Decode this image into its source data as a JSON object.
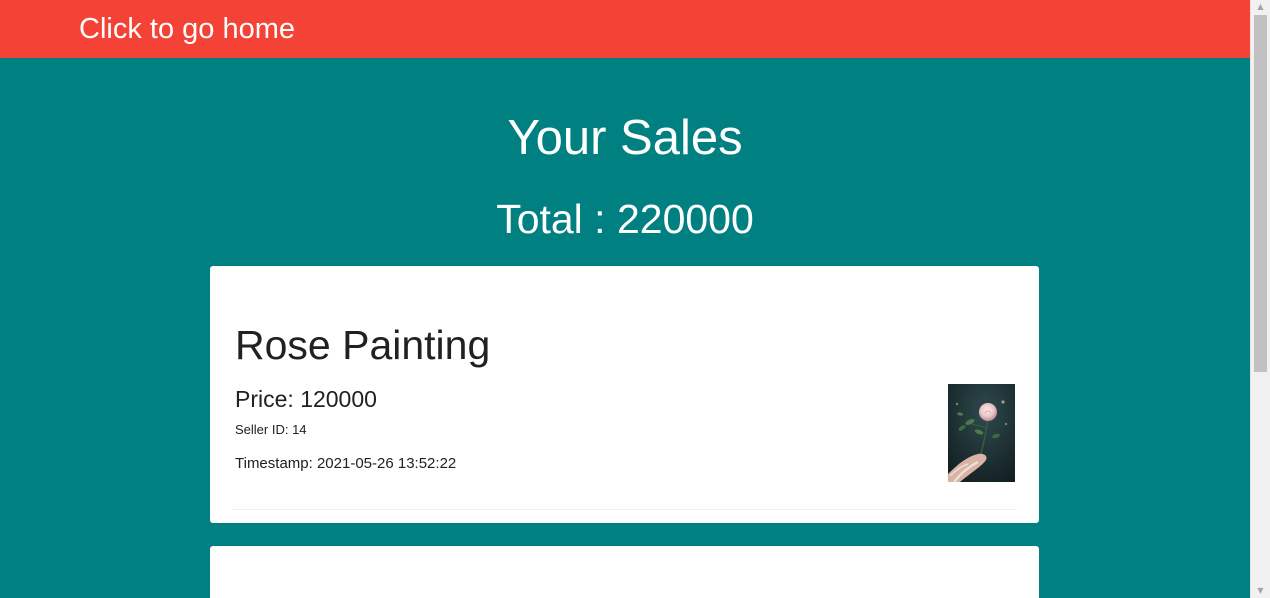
{
  "header": {
    "home_link": "Click to go home"
  },
  "main": {
    "title": "Your Sales",
    "total_label": "Total : ",
    "total_value": "220000"
  },
  "sales": [
    {
      "name": "Rose Painting",
      "price_label": "Price: ",
      "price": "120000",
      "seller_label": "Seller ID: ",
      "seller_id": "14",
      "timestamp_label": "Timestamp: ",
      "timestamp": "2021-05-26 13:52:22",
      "thumbnail": "rose-painting-thumbnail"
    }
  ],
  "scrollbar": {
    "up_icon": "chevron-up-icon",
    "down_icon": "chevron-down-icon"
  },
  "colors": {
    "header_bg": "#f44336",
    "page_bg": "#008080",
    "card_bg": "#ffffff",
    "text_light": "#ffffff",
    "text_dark": "#212121"
  }
}
